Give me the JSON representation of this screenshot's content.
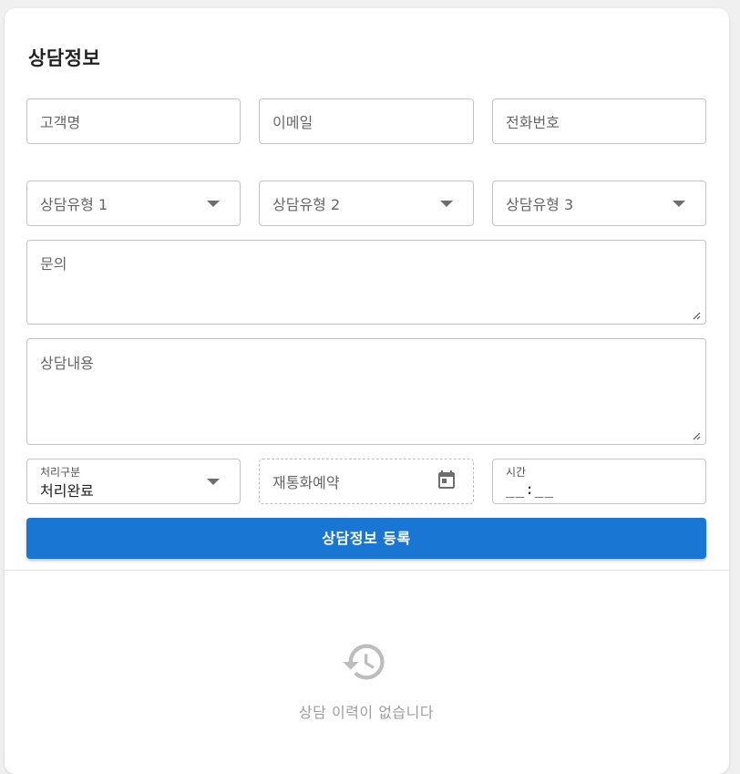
{
  "form": {
    "title": "상담정보",
    "customer_name_placeholder": "고객명",
    "email_placeholder": "이메일",
    "phone_placeholder": "전화번호",
    "type1_placeholder": "상담유형 1",
    "type2_placeholder": "상담유형 2",
    "type3_placeholder": "상담유형 3",
    "inquiry_placeholder": "문의",
    "content_placeholder": "상담내용",
    "status": {
      "label": "처리구분",
      "value": "처리완료"
    },
    "callback_placeholder": "재통화예약",
    "time": {
      "label": "시간",
      "value": "__:__"
    },
    "submit_label": "상담정보 등록"
  },
  "history": {
    "empty_text": "상담 이력이 없습니다",
    "icon": "history-icon"
  },
  "colors": {
    "primary": "#1976d2",
    "border": "#c4c4c4",
    "muted": "#9e9e9e"
  }
}
